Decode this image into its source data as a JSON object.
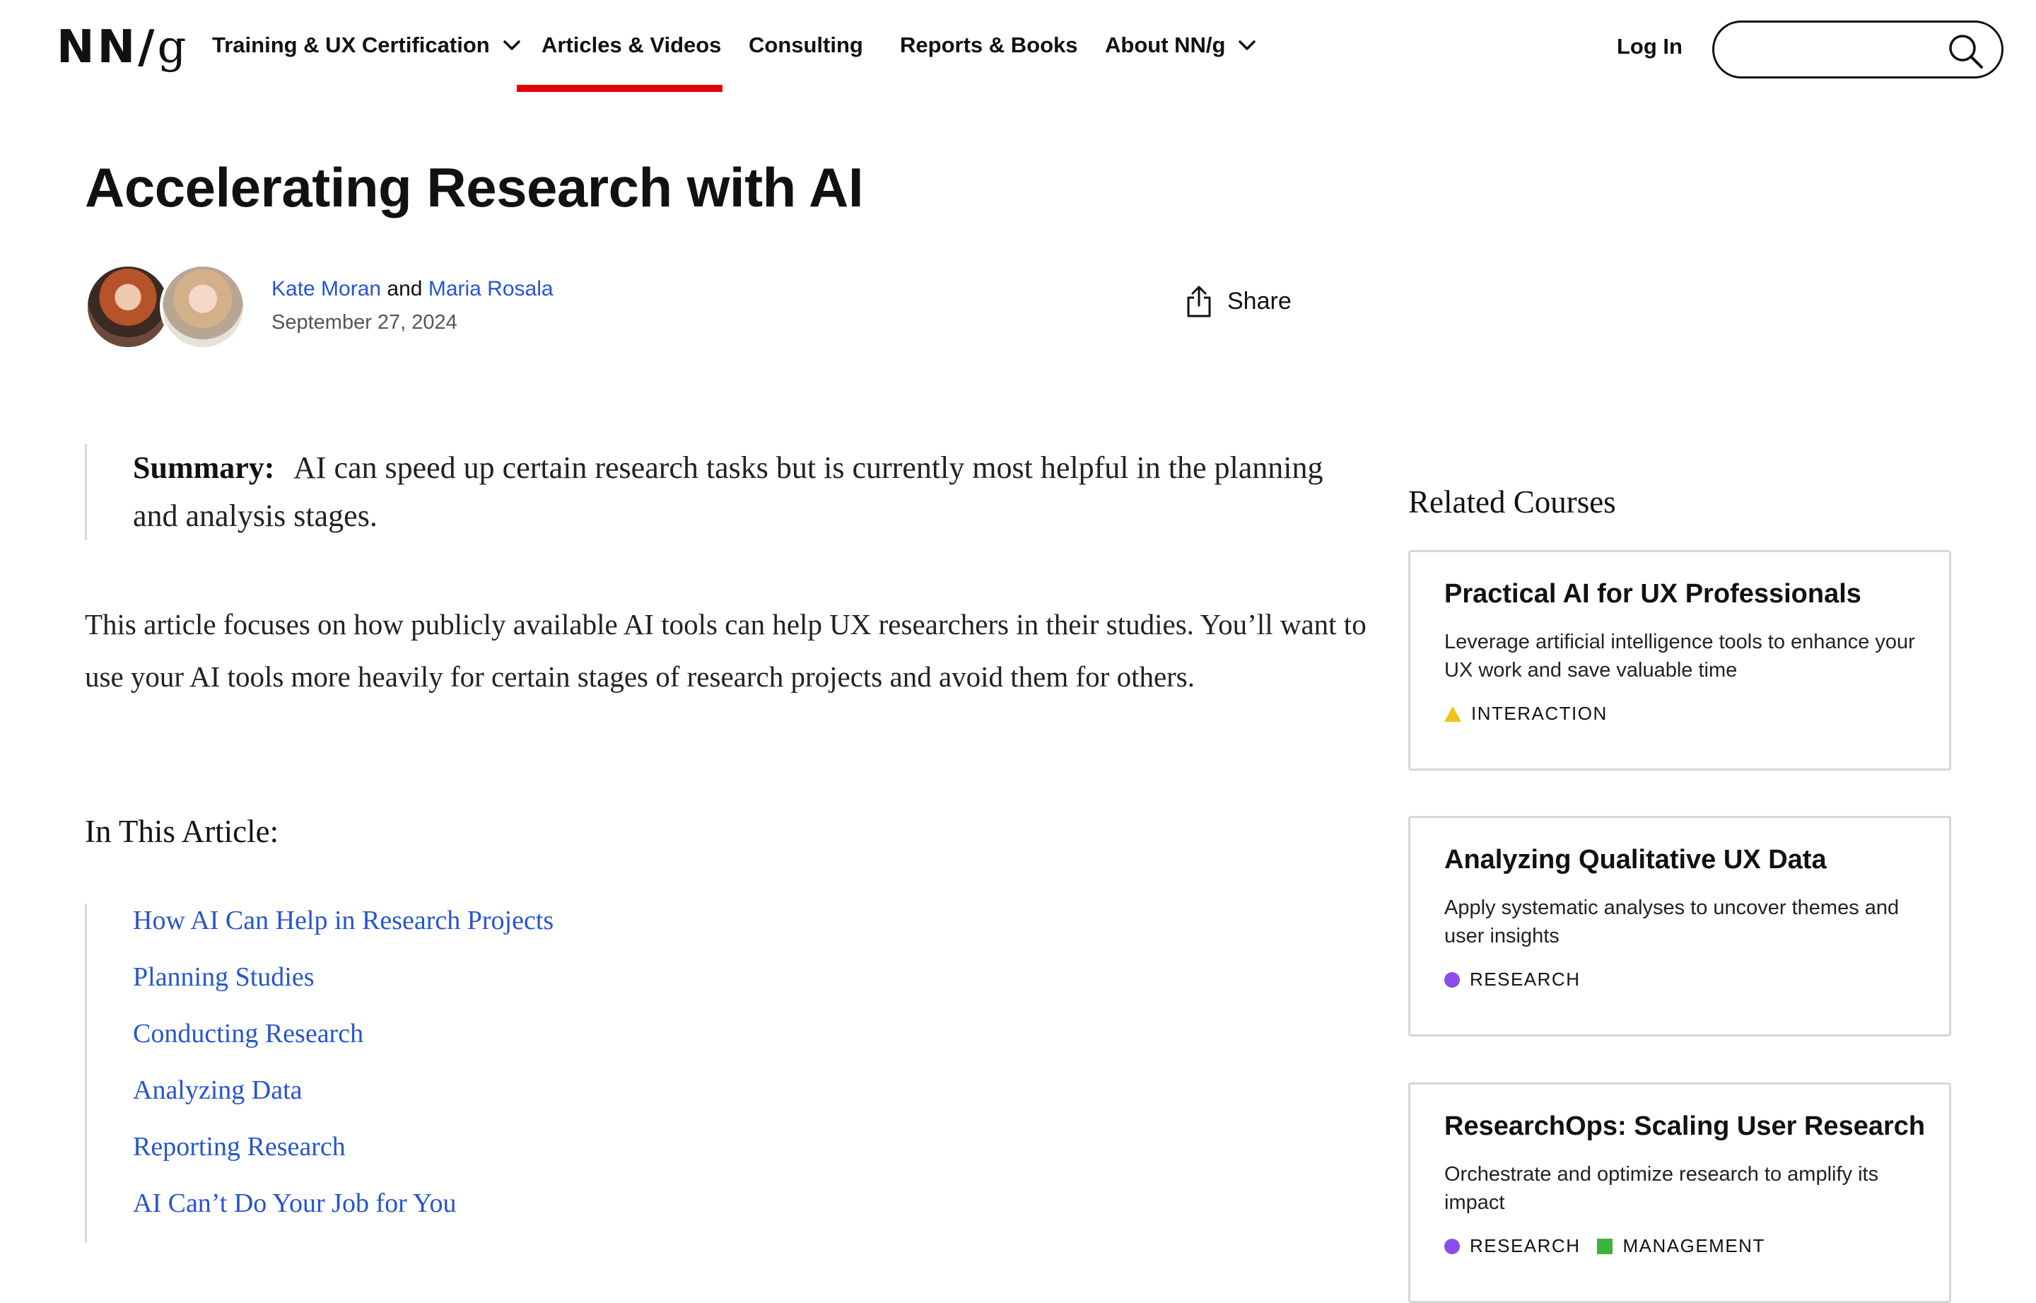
{
  "header": {
    "logo": {
      "prefix": "NN/",
      "suffix": "g"
    },
    "nav": [
      {
        "label": "Training & UX Certification",
        "has_dropdown": true
      },
      {
        "label": "Articles & Videos",
        "active": true
      },
      {
        "label": "Consulting"
      },
      {
        "label": "Reports & Books"
      },
      {
        "label": "About NN/g",
        "has_dropdown": true
      }
    ],
    "login": "Log In",
    "search": {
      "placeholder": "",
      "icon": "search-icon"
    },
    "active_color": "#e20000"
  },
  "article": {
    "title": "Accelerating Research with AI",
    "authors": {
      "author1": "Kate Moran",
      "conjunction": " and ",
      "author2": "Maria Rosala"
    },
    "date": "September 27, 2024",
    "share": "Share",
    "summary": {
      "label": "Summary:",
      "text": "AI can speed up certain research tasks but is currently most helpful in the planning and analysis stages."
    },
    "intro": "This article focuses on how publicly available AI tools can help UX researchers in their studies. You’ll want to use your AI tools more heavily for certain stages of research projects and avoid them for others.",
    "toc_title": "In This Article:",
    "toc": [
      "How AI Can Help in Research Projects",
      "Planning Studies",
      "Conducting Research",
      "Analyzing Data",
      "Reporting Research",
      "AI Can’t Do Your Job for You"
    ],
    "link_color": "#2655cf"
  },
  "sidebar": {
    "title": "Related Courses",
    "courses": [
      {
        "title": "Practical AI for UX Professionals",
        "description": "Leverage artificial intelligence tools to enhance your UX work and save valuable time",
        "tags": [
          {
            "label": "INTERACTION",
            "shape": "triangle",
            "color": "#f2c21b"
          }
        ]
      },
      {
        "title": "Analyzing Qualitative UX Data",
        "description": "Apply systematic analyses to uncover themes and user insights",
        "tags": [
          {
            "label": "RESEARCH",
            "shape": "circle",
            "color": "#8a4dea"
          }
        ]
      },
      {
        "title": "ResearchOps: Scaling User Research",
        "description": "Orchestrate and optimize research to amplify its impact",
        "tags": [
          {
            "label": "RESEARCH",
            "shape": "circle",
            "color": "#8a4dea"
          },
          {
            "label": "MANAGEMENT",
            "shape": "square",
            "color": "#3cb43c"
          }
        ]
      }
    ]
  }
}
